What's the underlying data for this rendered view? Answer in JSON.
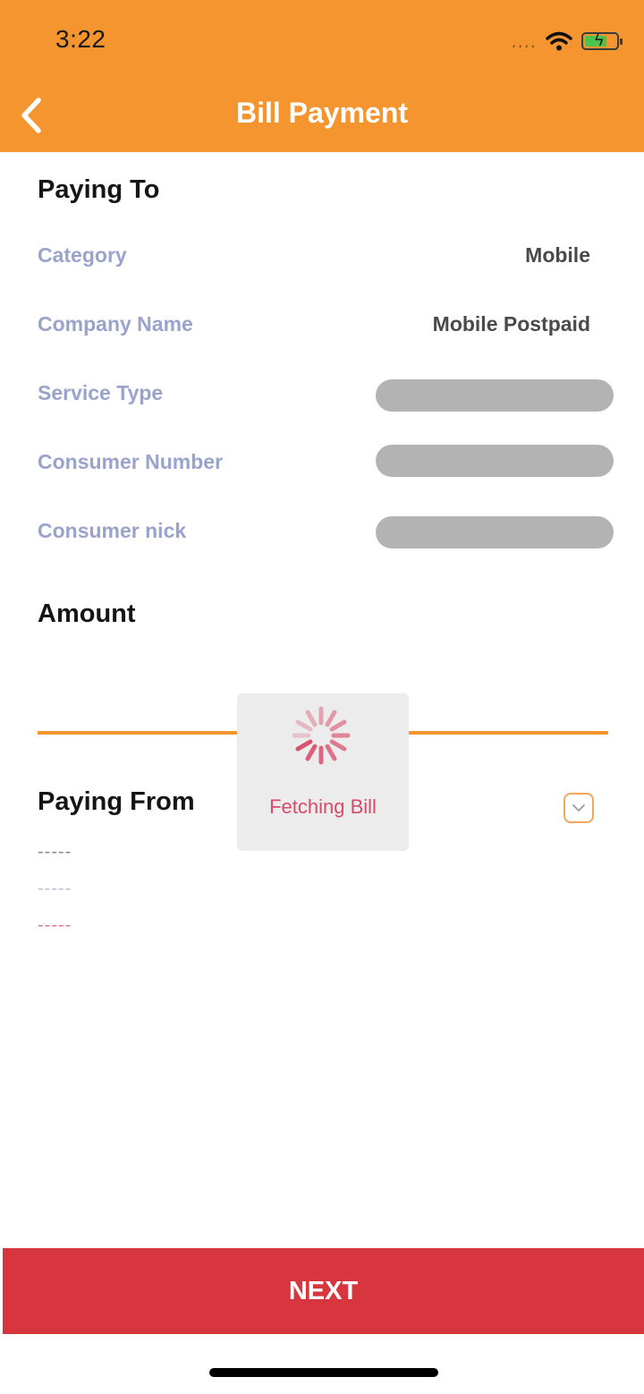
{
  "status_bar": {
    "time": "3:22",
    "signal": "....",
    "battery_level": 0.7
  },
  "header": {
    "title": "Bill Payment",
    "back_icon": "chevron-left-icon",
    "color": "#f4952f"
  },
  "paying_to": {
    "title": "Paying To",
    "rows": [
      {
        "label": "Category",
        "value": "Mobile"
      },
      {
        "label": "Company Name",
        "value": "Mobile Postpaid"
      },
      {
        "label": "Service Type",
        "value": null
      },
      {
        "label": "Consumer Number",
        "value": null
      },
      {
        "label": "Consumer nick",
        "value": null
      }
    ]
  },
  "amount": {
    "title": "Amount"
  },
  "paying_from": {
    "title": "Paying From",
    "dropdown_icon": "chevron-down-icon",
    "placeholders": [
      {
        "text": "-----",
        "color": "#8a8a8a"
      },
      {
        "text": "-----",
        "color": "#b9bde0"
      },
      {
        "text": "-----",
        "color": "#e07a8e"
      }
    ]
  },
  "loader": {
    "text": "Fetching Bill",
    "icon": "spinner-icon",
    "color": "#d84a6a"
  },
  "footer": {
    "next_label": "NEXT",
    "color": "#d8363e"
  }
}
